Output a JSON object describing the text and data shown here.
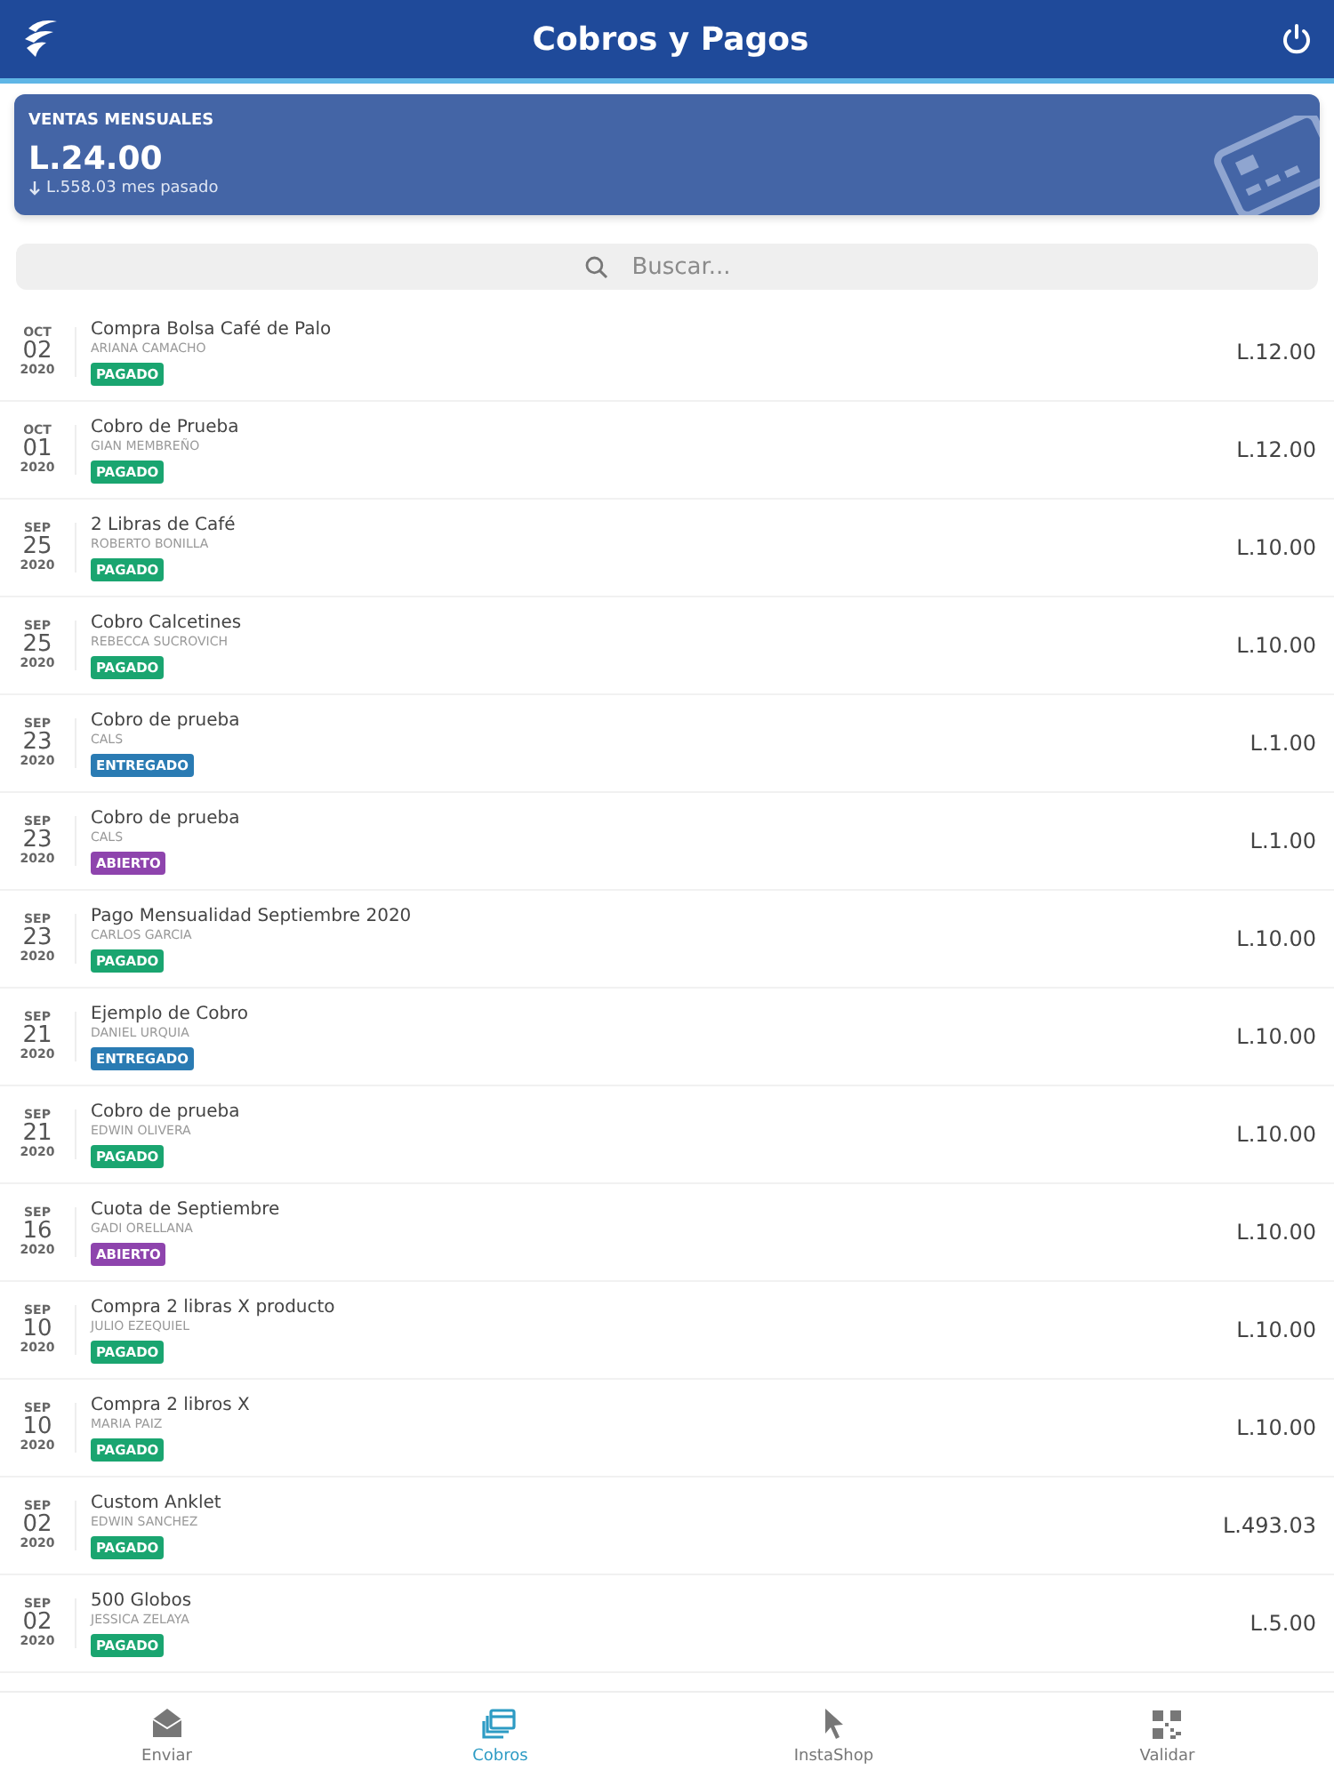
{
  "header": {
    "title": "Cobros y Pagos"
  },
  "summary": {
    "label": "VENTAS MENSUALES",
    "amount": "L.24.00",
    "previous": "L.558.03 mes pasado"
  },
  "search": {
    "placeholder": "Buscar..."
  },
  "transactions": [
    {
      "month": "OCT",
      "day": "02",
      "year": "2020",
      "title": "Compra Bolsa Café de Palo",
      "customer": "ARIANA CAMACHO",
      "status": "PAGADO",
      "color": "#1aa570",
      "amount": "L.12.00"
    },
    {
      "month": "OCT",
      "day": "01",
      "year": "2020",
      "title": "Cobro de Prueba",
      "customer": "GIAN MEMBREÑO",
      "status": "PAGADO",
      "color": "#1aa570",
      "amount": "L.12.00"
    },
    {
      "month": "SEP",
      "day": "25",
      "year": "2020",
      "title": "2 Libras de Café",
      "customer": "ROBERTO BONILLA",
      "status": "PAGADO",
      "color": "#1aa570",
      "amount": "L.10.00"
    },
    {
      "month": "SEP",
      "day": "25",
      "year": "2020",
      "title": "Cobro Calcetines",
      "customer": "REBECCA SUCROVICH",
      "status": "PAGADO",
      "color": "#1aa570",
      "amount": "L.10.00"
    },
    {
      "month": "SEP",
      "day": "23",
      "year": "2020",
      "title": "Cobro de prueba",
      "customer": "CALS",
      "status": "ENTREGADO",
      "color": "#2a7bb3",
      "amount": "L.1.00"
    },
    {
      "month": "SEP",
      "day": "23",
      "year": "2020",
      "title": "Cobro de prueba",
      "customer": "CALS",
      "status": "ABIERTO",
      "color": "#8e44ad",
      "amount": "L.1.00"
    },
    {
      "month": "SEP",
      "day": "23",
      "year": "2020",
      "title": "Pago Mensualidad Septiembre 2020",
      "customer": "CARLOS GARCIA",
      "status": "PAGADO",
      "color": "#1aa570",
      "amount": "L.10.00"
    },
    {
      "month": "SEP",
      "day": "21",
      "year": "2020",
      "title": "Ejemplo de Cobro",
      "customer": "DANIEL URQUIA",
      "status": "ENTREGADO",
      "color": "#2a7bb3",
      "amount": "L.10.00"
    },
    {
      "month": "SEP",
      "day": "21",
      "year": "2020",
      "title": "Cobro de prueba",
      "customer": "EDWIN OLIVERA",
      "status": "PAGADO",
      "color": "#1aa570",
      "amount": "L.10.00"
    },
    {
      "month": "SEP",
      "day": "16",
      "year": "2020",
      "title": "Cuota de Septiembre",
      "customer": "GADI ORELLANA",
      "status": "ABIERTO",
      "color": "#8e44ad",
      "amount": "L.10.00"
    },
    {
      "month": "SEP",
      "day": "10",
      "year": "2020",
      "title": "Compra 2 libras X producto",
      "customer": "JULIO EZEQUIEL",
      "status": "PAGADO",
      "color": "#1aa570",
      "amount": "L.10.00"
    },
    {
      "month": "SEP",
      "day": "10",
      "year": "2020",
      "title": "Compra 2 libros X",
      "customer": "MARIA PAIZ",
      "status": "PAGADO",
      "color": "#1aa570",
      "amount": "L.10.00"
    },
    {
      "month": "SEP",
      "day": "02",
      "year": "2020",
      "title": "Custom Anklet",
      "customer": "EDWIN SANCHEZ",
      "status": "PAGADO",
      "color": "#1aa570",
      "amount": "L.493.03"
    },
    {
      "month": "SEP",
      "day": "02",
      "year": "2020",
      "title": "500 Globos",
      "customer": "JESSICA ZELAYA",
      "status": "PAGADO",
      "color": "#1aa570",
      "amount": "L.5.00"
    }
  ],
  "tab_bar": [
    {
      "kind": "envelope",
      "label": "Enviar",
      "selected": false
    },
    {
      "kind": "cards",
      "label": "Cobros",
      "selected": true
    },
    {
      "kind": "pointer",
      "label": "InstaShop",
      "selected": false
    },
    {
      "kind": "qr",
      "label": "Validar",
      "selected": false
    }
  ]
}
